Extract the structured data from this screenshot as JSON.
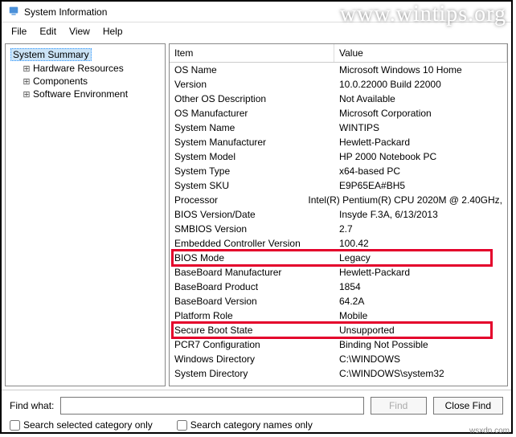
{
  "window": {
    "title": "System Information"
  },
  "menu": {
    "file": "File",
    "edit": "Edit",
    "view": "View",
    "help": "Help"
  },
  "tree": {
    "root": "System Summary",
    "children": [
      "Hardware Resources",
      "Components",
      "Software Environment"
    ]
  },
  "list": {
    "header_item": "Item",
    "header_value": "Value",
    "rows": [
      {
        "item": "OS Name",
        "value": "Microsoft Windows 10 Home"
      },
      {
        "item": "Version",
        "value": "10.0.22000 Build 22000"
      },
      {
        "item": "Other OS Description",
        "value": "Not Available"
      },
      {
        "item": "OS Manufacturer",
        "value": "Microsoft Corporation"
      },
      {
        "item": "System Name",
        "value": "WINTIPS"
      },
      {
        "item": "System Manufacturer",
        "value": "Hewlett-Packard"
      },
      {
        "item": "System Model",
        "value": "HP 2000 Notebook PC"
      },
      {
        "item": "System Type",
        "value": "x64-based PC"
      },
      {
        "item": "System SKU",
        "value": "E9P65EA#BH5"
      },
      {
        "item": "Processor",
        "value": "Intel(R) Pentium(R) CPU 2020M @ 2.40GHz,"
      },
      {
        "item": "BIOS Version/Date",
        "value": "Insyde F.3A, 6/13/2013"
      },
      {
        "item": "SMBIOS Version",
        "value": "2.7"
      },
      {
        "item": "Embedded Controller Version",
        "value": "100.42"
      },
      {
        "item": "BIOS Mode",
        "value": "Legacy"
      },
      {
        "item": "BaseBoard Manufacturer",
        "value": "Hewlett-Packard"
      },
      {
        "item": "BaseBoard Product",
        "value": "1854"
      },
      {
        "item": "BaseBoard Version",
        "value": "64.2A"
      },
      {
        "item": "Platform Role",
        "value": "Mobile"
      },
      {
        "item": "Secure Boot State",
        "value": "Unsupported"
      },
      {
        "item": "PCR7 Configuration",
        "value": "Binding Not Possible"
      },
      {
        "item": "Windows Directory",
        "value": "C:\\WINDOWS"
      },
      {
        "item": "System Directory",
        "value": "C:\\WINDOWS\\system32"
      }
    ],
    "highlighted": [
      13,
      18
    ]
  },
  "find": {
    "label": "Find what:",
    "find_button": "Find",
    "close_button": "Close Find",
    "check_selected": "Search selected category only",
    "check_names": "Search category names only"
  },
  "watermark": "www.wintips.org",
  "attribution": "wsxdn.com"
}
